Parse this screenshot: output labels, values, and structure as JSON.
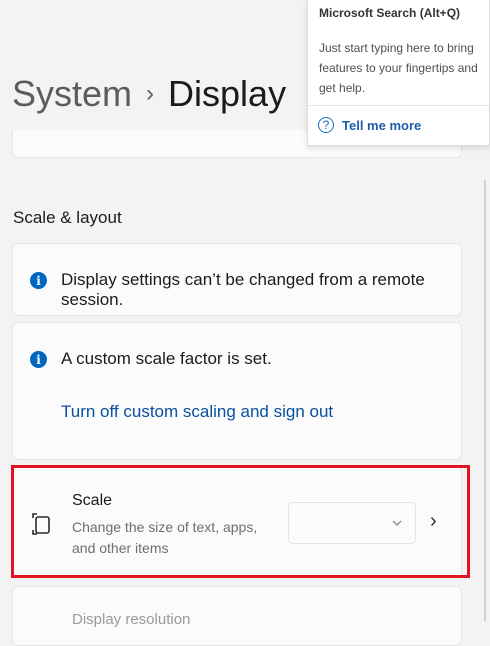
{
  "breadcrumb": {
    "parent": "System",
    "separator": "›",
    "current": "Display"
  },
  "section": {
    "title": "Scale & layout"
  },
  "remote_notice": {
    "icon": "info-icon",
    "text": "Display settings can’t be changed from a remote session."
  },
  "custom_scale": {
    "icon": "info-icon",
    "text": "A custom scale factor is set.",
    "link": "Turn off custom scaling and sign out"
  },
  "scale": {
    "icon": "scale-icon",
    "title": "Scale",
    "description": "Change the size of text, apps, and other items",
    "dropdown_value": "",
    "chevron": "›"
  },
  "resolution": {
    "title": "Display resolution"
  },
  "tooltip": {
    "title": "Microsoft Search (Alt+Q)",
    "body": "Just start typing here to bring features to your fingertips and get help.",
    "link": "Tell me more",
    "link_icon": "help-icon"
  },
  "colors": {
    "accent": "#0067c0",
    "link": "#0a4fa0",
    "highlight": "#e0151f",
    "background": "#f3f3f3"
  }
}
